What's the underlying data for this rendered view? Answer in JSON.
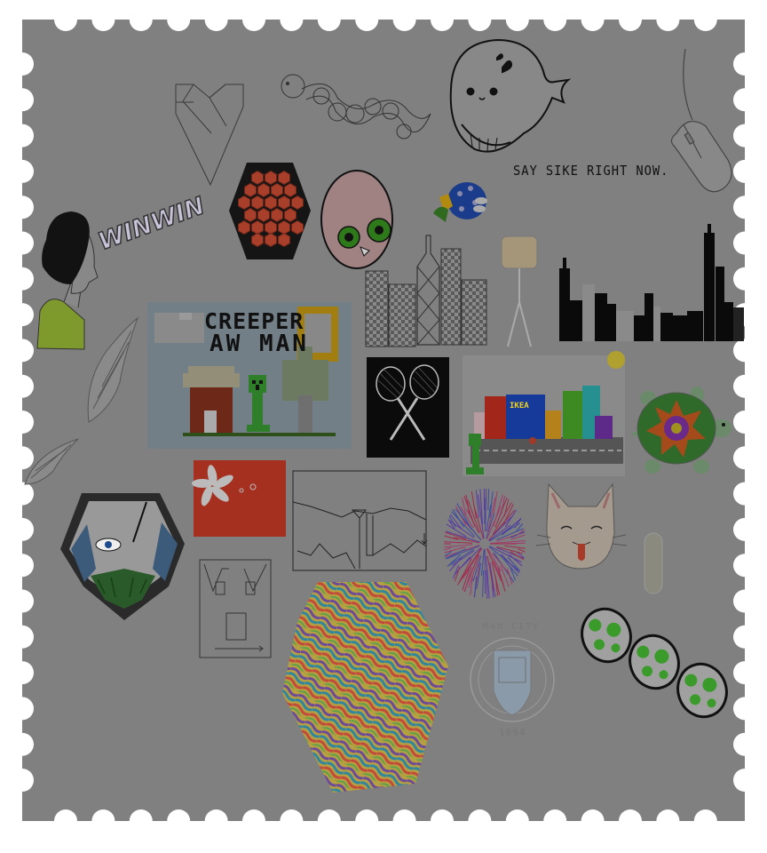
{
  "stamp": {
    "frame_color": "#808080",
    "border_color": "#ffffff",
    "artworks": [
      {
        "name": "origami-heart"
      },
      {
        "name": "snake-doodle"
      },
      {
        "name": "whale"
      },
      {
        "name": "computer-mouse"
      },
      {
        "name": "honeycomb-hexagon"
      },
      {
        "name": "pink-bird-face"
      },
      {
        "name": "blue-mushroom-bird"
      },
      {
        "name": "girl-profile"
      },
      {
        "name": "city-skyline"
      },
      {
        "name": "minecraft-scene"
      },
      {
        "name": "badminton-rackets"
      },
      {
        "name": "ikea-buildings"
      },
      {
        "name": "turtle"
      },
      {
        "name": "wing"
      },
      {
        "name": "hong-kong-flag"
      },
      {
        "name": "mountain-line"
      },
      {
        "name": "firework-burst"
      },
      {
        "name": "cat-face"
      },
      {
        "name": "masked-hero"
      },
      {
        "name": "line-face-box"
      },
      {
        "name": "rainbow-hexagon"
      },
      {
        "name": "man-city-badge"
      },
      {
        "name": "yoshi-eggs"
      }
    ]
  },
  "texts": {
    "say_sike": "SAY SIKE RIGHT NOW.",
    "winwin": "WINWIN",
    "creeper_line1": "CREEPER",
    "creeper_line2": "AW MAN",
    "ikea": "IKEA",
    "man_city": "MAN CITY",
    "man_city_year": "1894"
  }
}
